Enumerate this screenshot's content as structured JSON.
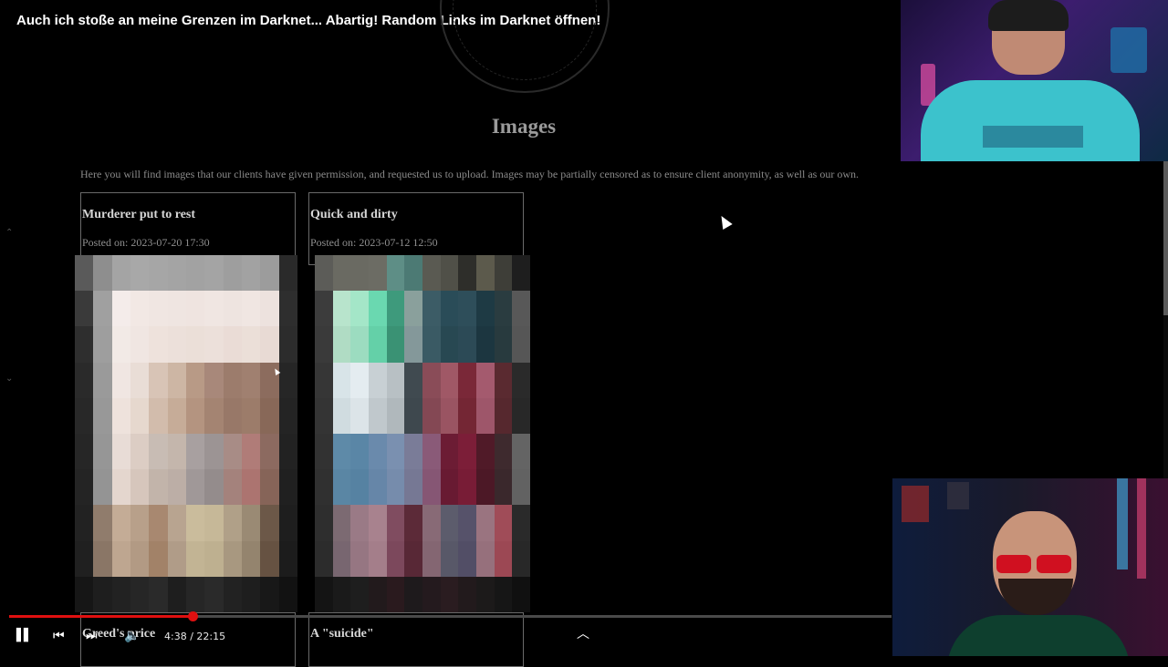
{
  "video": {
    "title": "Auch ich stoße an meine Grenzen im Darknet... Abartig! Random Links im Darknet öffnen!",
    "current_time": "4:38",
    "duration": "22:15",
    "time_separator": "/",
    "progress_fraction": 0.208
  },
  "page": {
    "heading": "Images",
    "intro": "Here you will find images that our clients have given permission, and requested us to upload. Images may be partially censored as to ensure client anonymity, as well as our own."
  },
  "cards": [
    {
      "title": "Murderer put to rest",
      "posted_label": "Posted on:",
      "date": "2023-07-20 17:30"
    },
    {
      "title": "Quick and dirty",
      "posted_label": "Posted on:",
      "date": "2023-07-12 12:50"
    },
    {
      "title": "Greed's price"
    },
    {
      "title": "A \"suicide\""
    }
  ],
  "icons": {
    "play_pause": "pause-icon",
    "previous": "skip-previous-icon",
    "next": "skip-next-icon",
    "volume": "volume-icon",
    "expand": "chevron-up-icon",
    "queue": "playlist-icon",
    "sidebar_up": "chevron-up-icon",
    "sidebar_down": "chevron-down-icon"
  },
  "colors": {
    "progress": "#e01010",
    "background": "#000000"
  }
}
